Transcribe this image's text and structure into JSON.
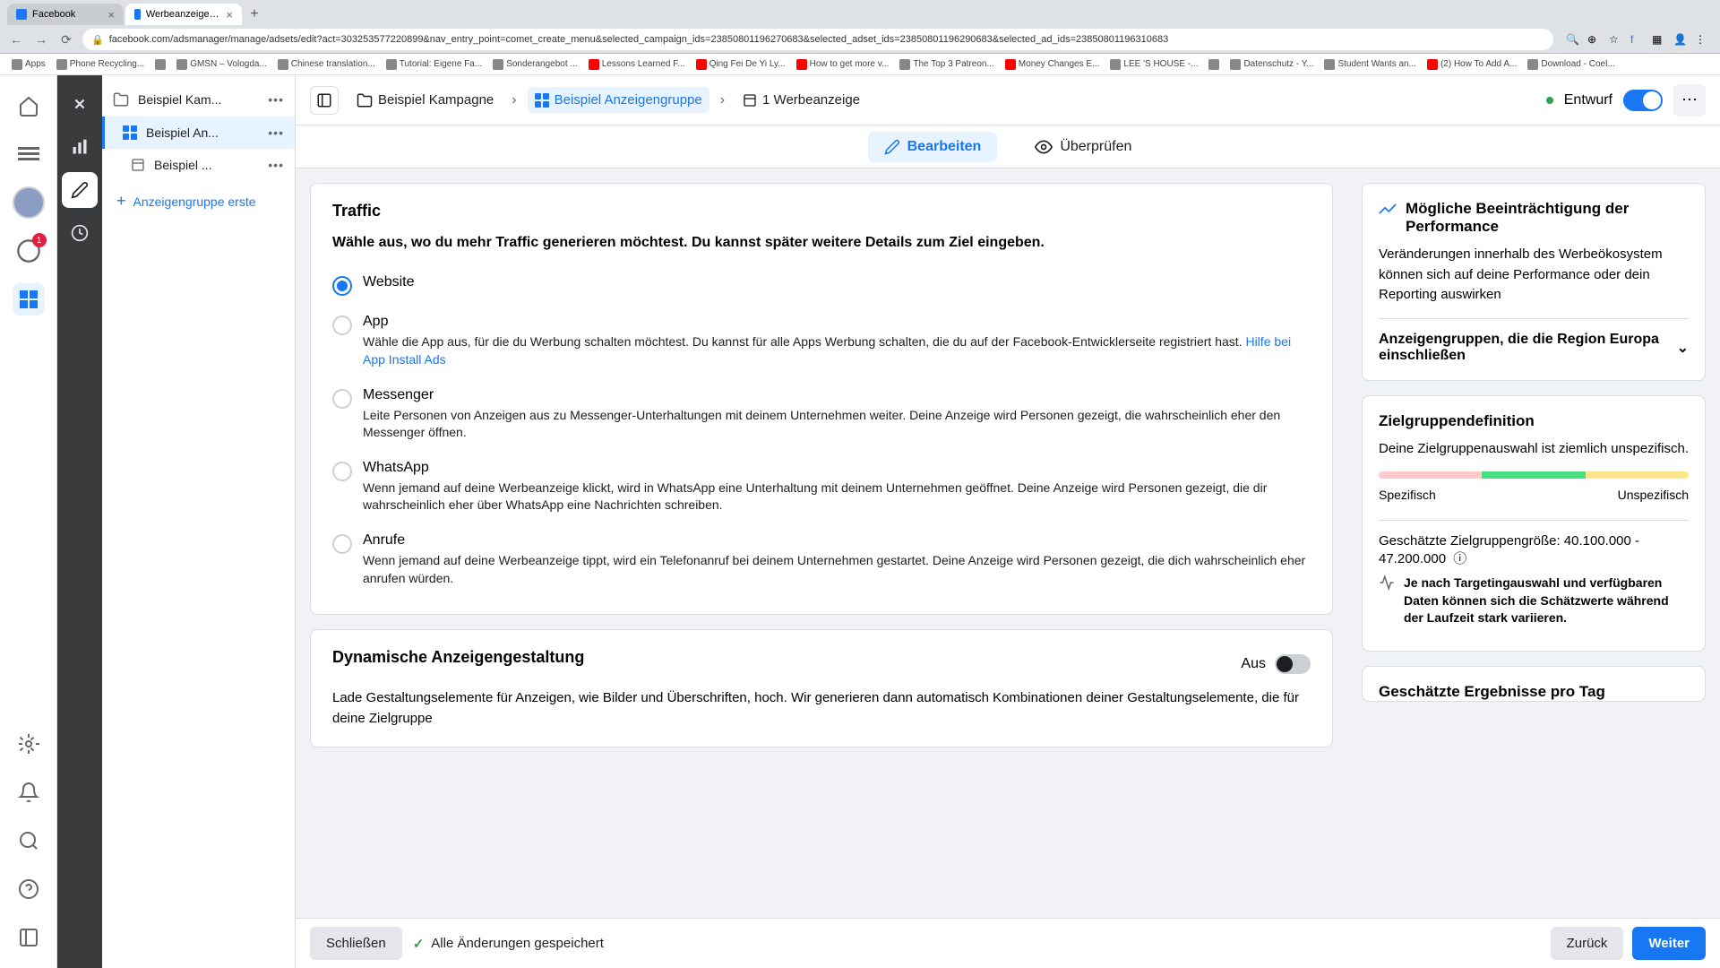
{
  "browser": {
    "tabs": [
      {
        "label": "Facebook",
        "active": false
      },
      {
        "label": "Werbeanzeigenmanager - We",
        "active": true
      }
    ],
    "url": "facebook.com/adsmanager/manage/adsets/edit?act=303253577220899&nav_entry_point=comet_create_menu&selected_campaign_ids=23850801196270683&selected_adset_ids=23850801196290683&selected_ad_ids=23850801196310683",
    "bookmarks": [
      "Apps",
      "Phone Recycling...",
      "",
      "GMSN – Vologda...",
      "Chinese translation...",
      "Tutorial: Eigene Fa...",
      "Sonderangebot ...",
      "Lessons Learned F...",
      "Qing Fei De Yi Ly...",
      "How to get more v...",
      "The Top 3 Patreon...",
      "Money Changes E...",
      "LEE 'S HOUSE -...",
      "",
      "Datenschutz - Y...",
      "Student Wants an...",
      "(2) How To Add A...",
      "Download - Coel..."
    ]
  },
  "rail": {
    "badge": "1"
  },
  "tree": {
    "campaign": "Beispiel Kam...",
    "adset": "Beispiel An...",
    "ad": "Beispiel ...",
    "create": "Anzeigengruppe erste"
  },
  "breadcrumb": {
    "campaign": "Beispiel Kampagne",
    "adset": "Beispiel Anzeigengruppe",
    "ad": "1 Werbeanzeige",
    "status": "Entwurf"
  },
  "tabs": {
    "edit": "Bearbeiten",
    "review": "Überprüfen"
  },
  "traffic": {
    "title": "Traffic",
    "subtitle": "Wähle aus, wo du mehr Traffic generieren möchtest. Du kannst später weitere Details zum Ziel eingeben.",
    "options": {
      "website": {
        "label": "Website"
      },
      "app": {
        "label": "App",
        "desc": "Wähle die App aus, für die du Werbung schalten möchtest. Du kannst für alle Apps Werbung schalten, die du auf der Facebook-Entwicklerseite registriert hast. ",
        "link": "Hilfe bei App Install Ads"
      },
      "messenger": {
        "label": "Messenger",
        "desc": "Leite Personen von Anzeigen aus zu Messenger-Unterhaltungen mit deinem Unternehmen weiter. Deine Anzeige wird Personen gezeigt, die wahrscheinlich eher den Messenger öffnen."
      },
      "whatsapp": {
        "label": "WhatsApp",
        "desc": "Wenn jemand auf deine Werbeanzeige klickt, wird in WhatsApp eine Unterhaltung mit deinem Unternehmen geöffnet. Deine Anzeige wird Personen gezeigt, die dir wahrscheinlich eher über WhatsApp eine Nachrichten schreiben."
      },
      "calls": {
        "label": "Anrufe",
        "desc": "Wenn jemand auf deine Werbeanzeige tippt, wird ein Telefonanruf bei deinem Unternehmen gestartet. Deine Anzeige wird Personen gezeigt, die dich wahrscheinlich eher anrufen würden."
      }
    }
  },
  "dynamic": {
    "title": "Dynamische Anzeigengestaltung",
    "off": "Aus",
    "desc": "Lade Gestaltungselemente für Anzeigen, wie Bilder und Überschriften, hoch. Wir generieren dann automatisch Kombinationen deiner Gestaltungselemente, die für deine Zielgruppe"
  },
  "perf": {
    "title": "Mögliche Beeinträchtigung der Performance",
    "text": "Veränderungen innerhalb des Werbeökosystem können sich auf deine Performance oder dein Reporting auswirken",
    "expand": "Anzeigengruppen, die die Region Europa einschließen"
  },
  "audience": {
    "title": "Zielgruppendefinition",
    "text": "Deine Zielgruppenauswahl ist ziemlich unspezifisch.",
    "left": "Spezifisch",
    "right": "Unspezifisch",
    "size_label": "Geschätzte Zielgruppengröße: ",
    "size": "40.100.000 - 47.200.000",
    "note": "Je nach Targetingauswahl und verfügbaren Daten können sich die Schätzwerte während der Laufzeit stark variieren.",
    "next_title": "Geschätzte Ergebnisse pro Tag"
  },
  "footer": {
    "close": "Schließen",
    "saved": "Alle Änderungen gespeichert",
    "back": "Zurück",
    "next": "Weiter"
  }
}
